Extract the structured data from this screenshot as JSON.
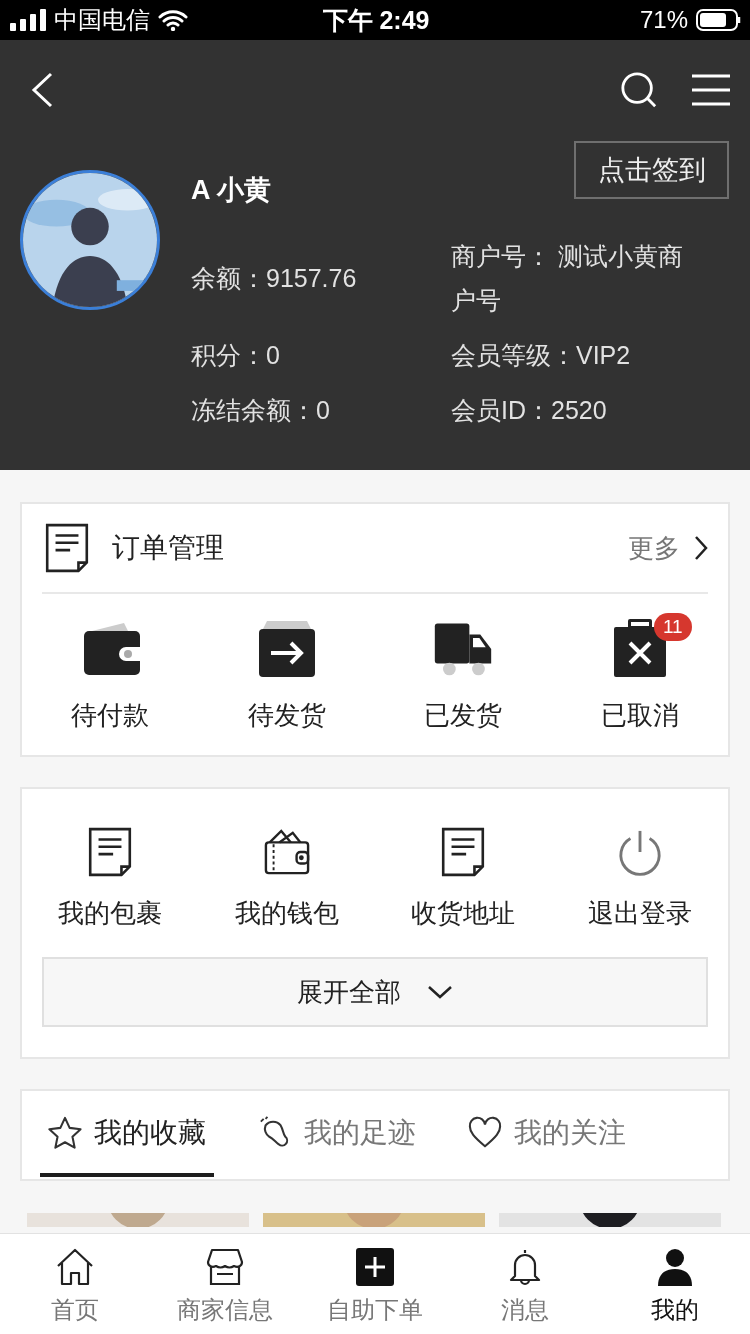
{
  "status_bar": {
    "carrier": "中国电信",
    "time": "下午 2:49",
    "battery": "71%"
  },
  "profile": {
    "sign_in_button": "点击签到",
    "name": "A 小黄",
    "info_rows": [
      {
        "left": "余额：9157.76",
        "right": "商户号： 测试小黄商户号"
      },
      {
        "left": "积分：0",
        "right": "会员等级：VIP2"
      },
      {
        "left": "冻结余额：0",
        "right": "会员ID：2520"
      }
    ]
  },
  "orders": {
    "title": "订单管理",
    "more": "更多",
    "items": [
      {
        "kind": "wallet",
        "label": "待付款"
      },
      {
        "kind": "box",
        "label": "待发货"
      },
      {
        "kind": "truck",
        "label": "已发货"
      },
      {
        "kind": "cancel",
        "label": "已取消",
        "badge": "11"
      }
    ]
  },
  "services": {
    "items": [
      {
        "kind": "doc",
        "label": "我的包裹"
      },
      {
        "kind": "purse",
        "label": "我的钱包"
      },
      {
        "kind": "doc",
        "label": "收货地址"
      },
      {
        "kind": "power",
        "label": "退出登录"
      }
    ],
    "expand_button": "展开全部"
  },
  "collection_tabs": [
    {
      "kind": "star",
      "label": "我的收藏",
      "selected": true
    },
    {
      "kind": "footprint",
      "label": "我的足迹",
      "selected": false
    },
    {
      "kind": "heart",
      "label": "我的关注",
      "selected": false
    }
  ],
  "tab_bar": [
    {
      "kind": "home",
      "label": "首页",
      "selected": false
    },
    {
      "kind": "shop",
      "label": "商家信息",
      "selected": false
    },
    {
      "kind": "plus",
      "label": "自助下单",
      "selected": false
    },
    {
      "kind": "bell",
      "label": "消息",
      "selected": false
    },
    {
      "kind": "person",
      "label": "我的",
      "selected": true
    }
  ]
}
